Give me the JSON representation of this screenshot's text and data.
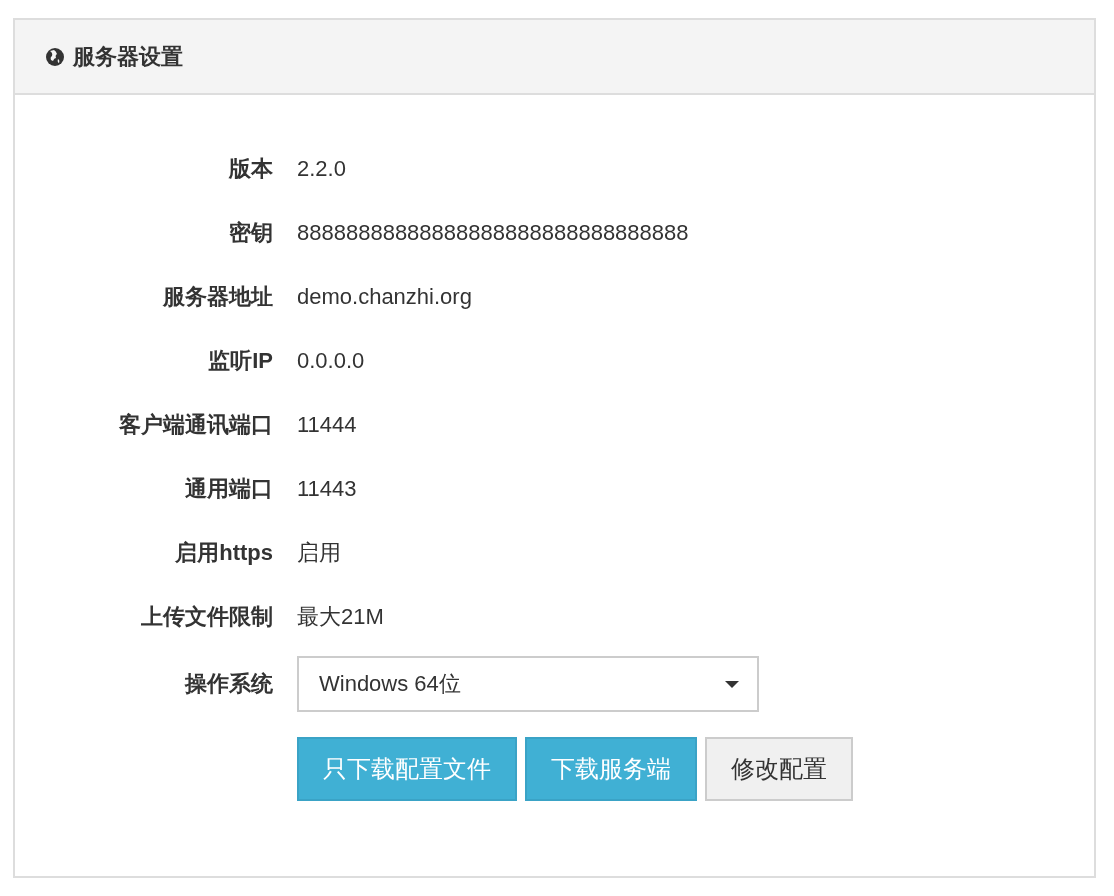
{
  "panel": {
    "title": "服务器设置"
  },
  "fields": [
    {
      "label": "版本",
      "value": "2.2.0"
    },
    {
      "label": "密钥",
      "value": "88888888888888888888888888888888"
    },
    {
      "label": "服务器地址",
      "value": "demo.chanzhi.org"
    },
    {
      "label": "监听IP",
      "value": "0.0.0.0"
    },
    {
      "label": "客户端通讯端口",
      "value": "11444"
    },
    {
      "label": "通用端口",
      "value": "11443"
    },
    {
      "label": "启用https",
      "value": "启用"
    },
    {
      "label": "上传文件限制",
      "value": "最大21M"
    }
  ],
  "os_select": {
    "label": "操作系统",
    "value": "Windows 64位"
  },
  "buttons": [
    {
      "label": "只下载配置文件",
      "kind": "primary"
    },
    {
      "label": "下载服务端",
      "kind": "primary"
    },
    {
      "label": "修改配置",
      "kind": "default"
    }
  ]
}
